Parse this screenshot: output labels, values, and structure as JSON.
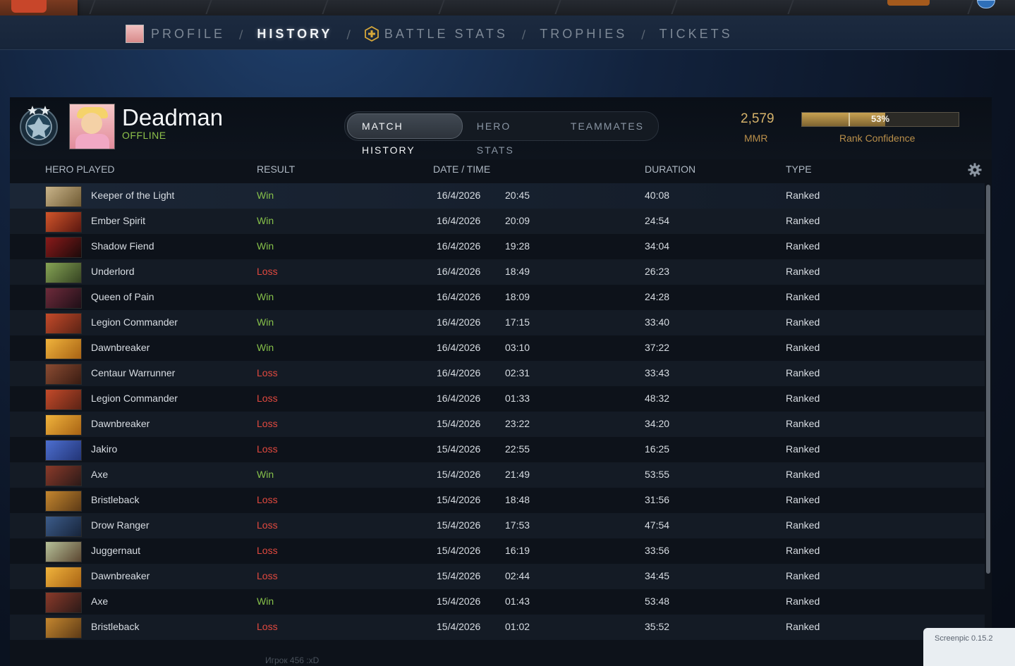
{
  "nav": {
    "items": [
      {
        "label": "PROFILE",
        "active": false,
        "icon": "avatar-icon"
      },
      {
        "label": "HISTORY",
        "active": true
      },
      {
        "label": "BATTLE STATS",
        "active": false,
        "icon": "plus-hex-icon"
      },
      {
        "label": "TROPHIES",
        "active": false
      },
      {
        "label": "TICKETS",
        "active": false
      }
    ],
    "separator": "/"
  },
  "player": {
    "name": "Deadman",
    "status": "OFFLINE"
  },
  "tabs": {
    "match_history": "MATCH HISTORY",
    "hero_stats": "HERO STATS",
    "teammates": "TEAMMATES"
  },
  "rank": {
    "mmr_value": "2,579",
    "mmr_label": "MMR",
    "confidence_text": "53%",
    "confidence_fraction": 0.53,
    "confidence_label": "Rank Confidence"
  },
  "table": {
    "headers": {
      "hero": "HERO PLAYED",
      "result": "RESULT",
      "datetime": "DATE / TIME",
      "duration": "DURATION",
      "type": "TYPE"
    },
    "rows": [
      {
        "hero": "Keeper of the Light",
        "result": "Win",
        "date": "16/4/2026",
        "time": "20:45",
        "duration": "40:08",
        "type": "Ranked"
      },
      {
        "hero": "Ember Spirit",
        "result": "Win",
        "date": "16/4/2026",
        "time": "20:09",
        "duration": "24:54",
        "type": "Ranked"
      },
      {
        "hero": "Shadow Fiend",
        "result": "Win",
        "date": "16/4/2026",
        "time": "19:28",
        "duration": "34:04",
        "type": "Ranked"
      },
      {
        "hero": "Underlord",
        "result": "Loss",
        "date": "16/4/2026",
        "time": "18:49",
        "duration": "26:23",
        "type": "Ranked"
      },
      {
        "hero": "Queen of Pain",
        "result": "Win",
        "date": "16/4/2026",
        "time": "18:09",
        "duration": "24:28",
        "type": "Ranked"
      },
      {
        "hero": "Legion Commander",
        "result": "Win",
        "date": "16/4/2026",
        "time": "17:15",
        "duration": "33:40",
        "type": "Ranked"
      },
      {
        "hero": "Dawnbreaker",
        "result": "Win",
        "date": "16/4/2026",
        "time": "03:10",
        "duration": "37:22",
        "type": "Ranked"
      },
      {
        "hero": "Centaur Warrunner",
        "result": "Loss",
        "date": "16/4/2026",
        "time": "02:31",
        "duration": "33:43",
        "type": "Ranked"
      },
      {
        "hero": "Legion Commander",
        "result": "Loss",
        "date": "16/4/2026",
        "time": "01:33",
        "duration": "48:32",
        "type": "Ranked"
      },
      {
        "hero": "Dawnbreaker",
        "result": "Loss",
        "date": "15/4/2026",
        "time": "23:22",
        "duration": "34:20",
        "type": "Ranked"
      },
      {
        "hero": "Jakiro",
        "result": "Loss",
        "date": "15/4/2026",
        "time": "22:55",
        "duration": "16:25",
        "type": "Ranked"
      },
      {
        "hero": "Axe",
        "result": "Win",
        "date": "15/4/2026",
        "time": "21:49",
        "duration": "53:55",
        "type": "Ranked"
      },
      {
        "hero": "Bristleback",
        "result": "Loss",
        "date": "15/4/2026",
        "time": "18:48",
        "duration": "31:56",
        "type": "Ranked"
      },
      {
        "hero": "Drow Ranger",
        "result": "Loss",
        "date": "15/4/2026",
        "time": "17:53",
        "duration": "47:54",
        "type": "Ranked"
      },
      {
        "hero": "Juggernaut",
        "result": "Loss",
        "date": "15/4/2026",
        "time": "16:19",
        "duration": "33:56",
        "type": "Ranked"
      },
      {
        "hero": "Dawnbreaker",
        "result": "Loss",
        "date": "15/4/2026",
        "time": "02:44",
        "duration": "34:45",
        "type": "Ranked"
      },
      {
        "hero": "Axe",
        "result": "Win",
        "date": "15/4/2026",
        "time": "01:43",
        "duration": "53:48",
        "type": "Ranked"
      },
      {
        "hero": "Bristleback",
        "result": "Loss",
        "date": "15/4/2026",
        "time": "01:02",
        "duration": "35:52",
        "type": "Ranked"
      }
    ]
  },
  "hero_colors": {
    "Keeper of the Light": [
      "#c9b48a",
      "#6f5a33"
    ],
    "Ember Spirit": [
      "#d2552a",
      "#5a1710"
    ],
    "Shadow Fiend": [
      "#8a1a1a",
      "#1c0a0a"
    ],
    "Underlord": [
      "#86a455",
      "#354322"
    ],
    "Queen of Pain": [
      "#6e2b3b",
      "#1f0f17"
    ],
    "Legion Commander": [
      "#c44a2a",
      "#5b2315"
    ],
    "Dawnbreaker": [
      "#f0b33c",
      "#a86314"
    ],
    "Centaur Warrunner": [
      "#8a4b32",
      "#3a1c12"
    ],
    "Jakiro": [
      "#4d6fd0",
      "#233577"
    ],
    "Axe": [
      "#8a3a2a",
      "#2c1a18"
    ],
    "Bristleback": [
      "#c4872f",
      "#5d3a16"
    ],
    "Drow Ranger": [
      "#3c5c8a",
      "#17243a"
    ],
    "Juggernaut": [
      "#b6c19a",
      "#5b4630"
    ]
  },
  "colors": {
    "win": "#86c04a",
    "loss": "#e2493f",
    "status_online": "#8ec14a",
    "accent_gold": "#d5b26a"
  },
  "footer": {
    "ghost_text": "Игрок 456 :xD",
    "screenpic_label": "Screenpic 0.15.2"
  }
}
